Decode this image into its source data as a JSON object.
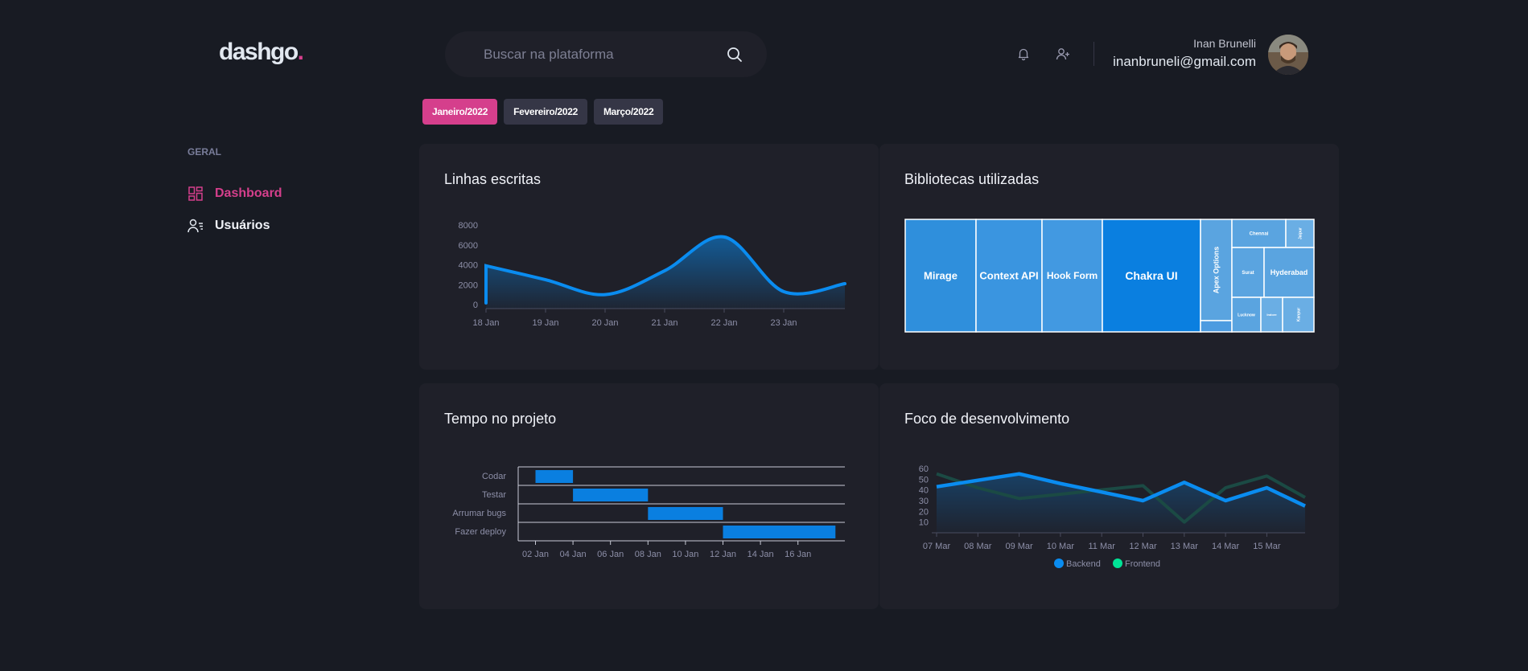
{
  "brand": {
    "name": "dashgo",
    "dot": "."
  },
  "search": {
    "placeholder": "Buscar na plataforma"
  },
  "header": {
    "icons": [
      "bell-icon",
      "user-plus-icon"
    ]
  },
  "user": {
    "name": "Inan Brunelli",
    "email": "inanbruneli@gmail.com"
  },
  "tabs": [
    {
      "label": "Janeiro/2022",
      "active": true
    },
    {
      "label": "Fevereiro/2022",
      "active": false
    },
    {
      "label": "Março/2022",
      "active": false
    }
  ],
  "sidebar": {
    "section": "GERAL",
    "items": [
      {
        "label": "Dashboard",
        "icon": "dashboard-icon",
        "active": true
      },
      {
        "label": "Usuários",
        "icon": "users-icon",
        "active": false
      }
    ]
  },
  "colors": {
    "accent": "#d53f8c",
    "series_blue": "#0a8cf0",
    "series_green": "#00e396"
  },
  "cards": {
    "lines": {
      "title": "Linhas escritas"
    },
    "libs": {
      "title": "Bibliotecas utilizadas"
    },
    "time": {
      "title": "Tempo no projeto"
    },
    "focus": {
      "title": "Foco de desenvolvimento"
    }
  },
  "chart_data": [
    {
      "type": "area",
      "title": "Linhas escritas",
      "x": [
        "18 Jan",
        "19 Jan",
        "20 Jan",
        "21 Jan",
        "22 Jan",
        "23 Jan"
      ],
      "yticks": [
        0,
        2000,
        4000,
        6000,
        8000
      ],
      "ylim": [
        0,
        8000
      ],
      "series": [
        {
          "values": [
            3900,
            2500,
            1000,
            3400,
            6800,
            1300,
            2100
          ]
        }
      ]
    },
    {
      "type": "treemap",
      "title": "Bibliotecas utilizadas",
      "labels": [
        "Mirage",
        "Context API",
        "Hook Form",
        "Chakra UI",
        "Apex Options",
        "Chennai",
        "Jaipur",
        "Surat",
        "Hyderabad",
        "Lucknow",
        "Indore",
        "Kanpur"
      ]
    },
    {
      "type": "gantt",
      "title": "Tempo no projeto",
      "x": [
        "02 Jan",
        "04 Jan",
        "06 Jan",
        "08 Jan",
        "10 Jan",
        "12 Jan",
        "14 Jan",
        "16 Jan"
      ],
      "tasks": [
        {
          "label": "Codar",
          "start": 2,
          "end": 4
        },
        {
          "label": "Testar",
          "start": 4,
          "end": 8
        },
        {
          "label": "Arrumar bugs",
          "start": 8,
          "end": 12
        },
        {
          "label": "Fazer deploy",
          "start": 12,
          "end": 18
        }
      ]
    },
    {
      "type": "line",
      "title": "Foco de desenvolvimento",
      "x": [
        "07 Mar",
        "08 Mar",
        "09 Mar",
        "10 Mar",
        "11 Mar",
        "12 Mar",
        "13 Mar",
        "14 Mar",
        "15 Mar"
      ],
      "yticks": [
        10,
        20,
        30,
        40,
        50,
        60
      ],
      "ylim": [
        0,
        60
      ],
      "series": [
        {
          "name": "Backend",
          "values": [
            43,
            49,
            55,
            46,
            38,
            30,
            47,
            30,
            42,
            25
          ]
        },
        {
          "name": "Frontend",
          "values": [
            55,
            42,
            32,
            36,
            40,
            44,
            10,
            42,
            53,
            33
          ]
        }
      ]
    }
  ]
}
